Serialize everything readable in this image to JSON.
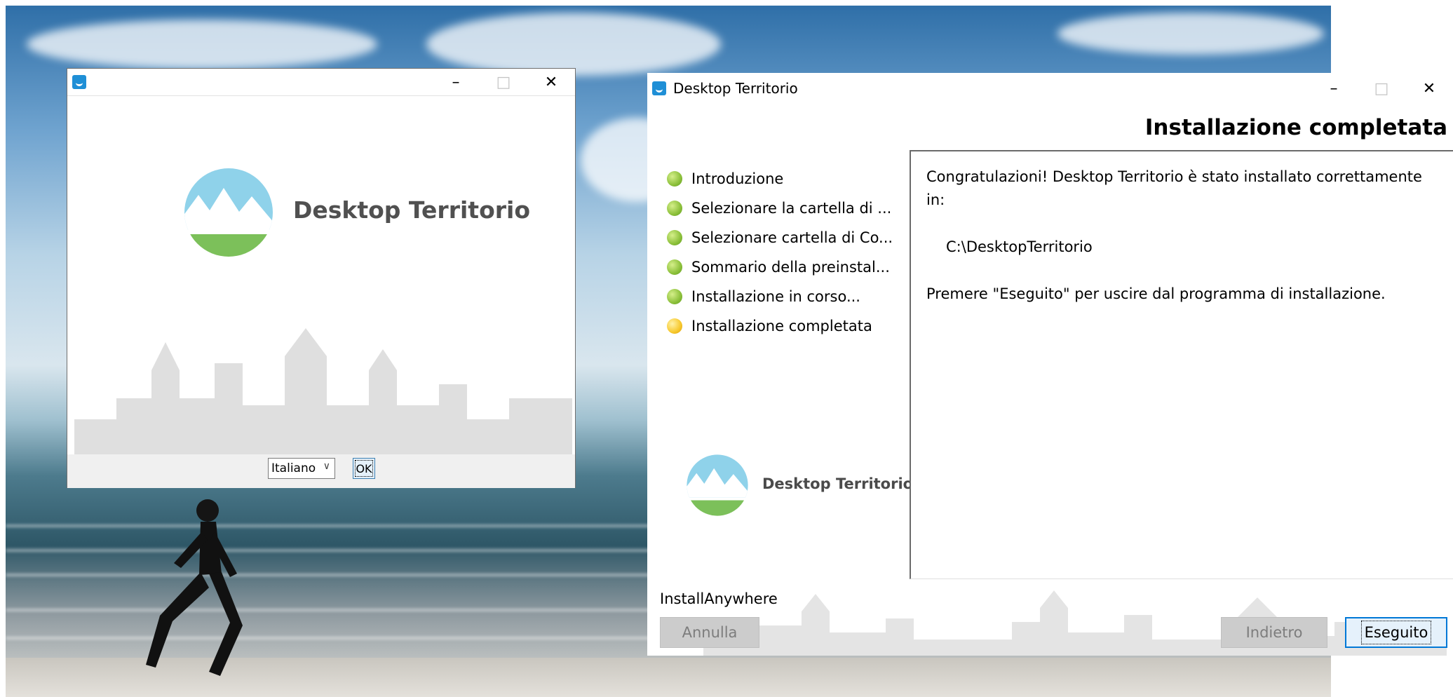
{
  "colors": {
    "accent": "#0078d7",
    "step_done": "#8cc03a",
    "step_current": "#f7c82c",
    "logo_blue": "#8fd2ea",
    "logo_green": "#7cc05a"
  },
  "language_dialog": {
    "title": "",
    "icons": {
      "minimize": "minimize-icon",
      "maximize": "maximize-icon",
      "close": "close-icon"
    },
    "logo_text": "Desktop Territorio",
    "language_selected": "Italiano",
    "ok_label": "OK"
  },
  "installer": {
    "title": "Desktop Territorio",
    "heading": "Installazione completata",
    "steps": [
      {
        "label": "Introduzione",
        "state": "done"
      },
      {
        "label": "Selezionare la cartella di ...",
        "state": "done"
      },
      {
        "label": "Selezionare cartella di Co...",
        "state": "done"
      },
      {
        "label": "Sommario della preinstal...",
        "state": "done"
      },
      {
        "label": "Installazione in corso...",
        "state": "done"
      },
      {
        "label": "Installazione completata",
        "state": "current"
      }
    ],
    "side_logo_text": "Desktop Territorio",
    "message_line1": "Congratulazioni! Desktop Territorio è stato installato correttamente",
    "message_line2": "in:",
    "install_path": "C:\\DesktopTerritorio",
    "exit_message": "Premere \"Eseguito\" per uscire dal programma di installazione.",
    "footer_brand": "InstallAnywhere",
    "buttons": {
      "cancel": "Annulla",
      "back": "Indietro",
      "done": "Eseguito"
    }
  }
}
